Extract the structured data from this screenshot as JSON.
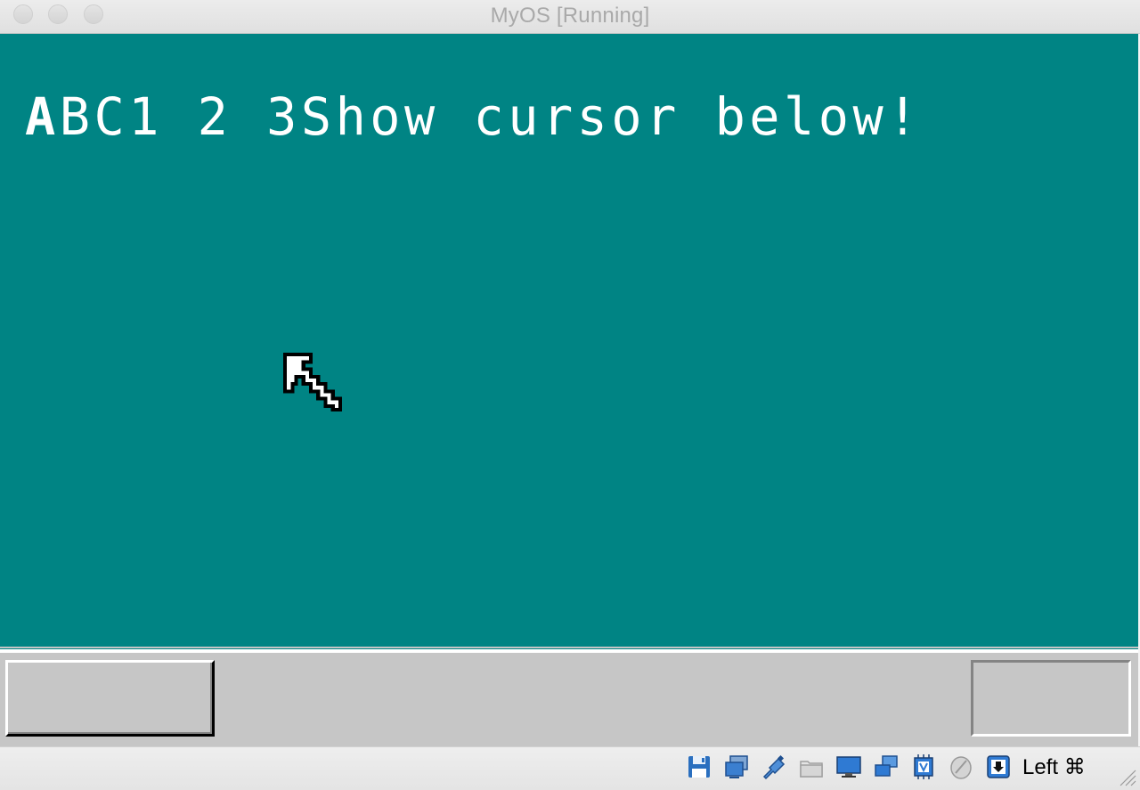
{
  "window": {
    "title": "MyOS [Running]"
  },
  "vm": {
    "background": "#008484",
    "text_first_char": "A",
    "text_rest": "BC1 2 3Show cursor below!",
    "taskbar_color": "#c6c6c6"
  },
  "statusbar": {
    "icons": [
      "hard-disk-icon",
      "optical-drive-icon",
      "usb-icon",
      "shared-folders-icon",
      "display-icon",
      "network-icon",
      "cpu-icon",
      "mouse-integration-icon",
      "host-key-capture-icon"
    ],
    "host_key_label": "Left ⌘"
  }
}
